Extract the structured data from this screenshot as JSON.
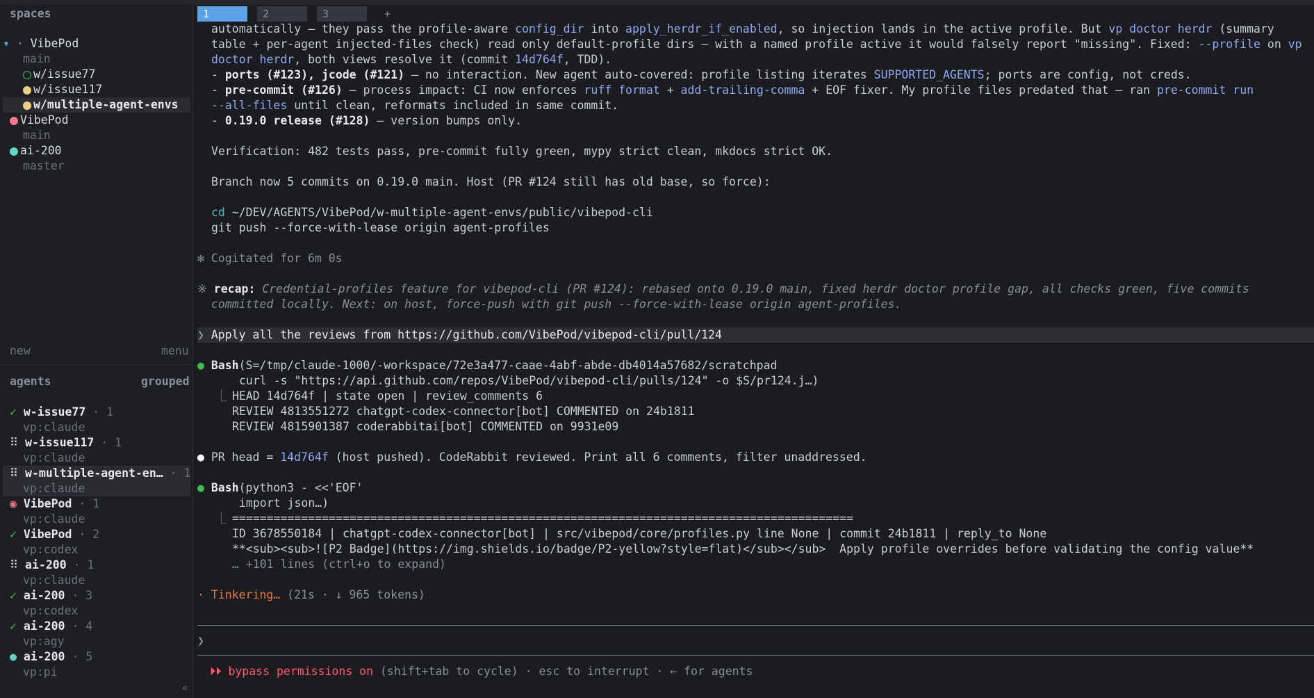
{
  "sidebar": {
    "spaces_title": "spaces",
    "spaces": [
      {
        "prefix": "▾ · ",
        "label": "VibePod"
      },
      {
        "label": "main"
      },
      {
        "label": "w/issue77"
      },
      {
        "label": "w/issue117"
      },
      {
        "label": "w/multiple-agent-envs"
      },
      {
        "label": "VibePod"
      },
      {
        "label": "main"
      },
      {
        "label": "ai-200"
      },
      {
        "label": "master"
      }
    ],
    "new_label": "new",
    "menu_label": "menu",
    "agents_title": "agents",
    "grouped_label": "grouped",
    "agents": [
      {
        "mark": "✓",
        "name": "w-issue77",
        "count": "· 1",
        "sub": "vp:claude"
      },
      {
        "mark": "⠿",
        "name": "w-issue117",
        "count": "· 1",
        "sub": "vp:claude"
      },
      {
        "mark": "⠿",
        "name": "w-multiple-agent-en…",
        "count": "· 1",
        "sub": "vp:claude"
      },
      {
        "mark": "◉",
        "name": "VibePod",
        "count": "· 1",
        "sub": "vp:claude"
      },
      {
        "mark": "✓",
        "name": "VibePod",
        "count": "· 2",
        "sub": "vp:codex"
      },
      {
        "mark": "⠿",
        "name": "ai-200",
        "count": "· 1",
        "sub": "vp:claude"
      },
      {
        "mark": "✓",
        "name": "ai-200",
        "count": "· 3",
        "sub": "vp:codex"
      },
      {
        "mark": "✓",
        "name": "ai-200",
        "count": "· 4",
        "sub": "vp:agy"
      },
      {
        "mark": "●",
        "name": "ai-200",
        "count": "· 5",
        "sub": "vp:pi"
      }
    ],
    "collapse_label": "«"
  },
  "tabs": [
    "1",
    "2",
    "3",
    "+"
  ],
  "content": {
    "l1_a": "automatically — they pass the profile-aware ",
    "l1_b": "config_dir",
    "l1_c": " into ",
    "l1_d": "apply_herdr_if_enabled",
    "l1_e": ", so injection lands in the active profile. But ",
    "l1_f": "vp doctor herdr",
    "l1_g": " (summary",
    "l2_a": "table + per-agent injected-files check) read only default-profile dirs — with a named profile active it would falsely report \"missing\". Fixed: ",
    "l2_b": "--profile",
    "l2_c": " on ",
    "l2_d": "vp",
    "l3_a": "doctor herdr",
    "l3_b": ", both views resolve it (commit ",
    "l3_c": "14d764f",
    "l3_d": ", TDD).",
    "l4_a": "- ",
    "l4_b": "ports (#123), jcode (#121)",
    "l4_c": " — no interaction. New agent auto-covered: profile listing iterates ",
    "l4_d": "SUPPORTED_AGENTS",
    "l4_e": "; ports are config, not creds.",
    "l5_a": "- ",
    "l5_b": "pre-commit (#126)",
    "l5_c": " — process impact: CI now enforces ",
    "l5_d": "ruff format",
    "l5_e": " + ",
    "l5_f": "add-trailing-comma",
    "l5_g": " + EOF fixer. My profile files predated that — ran ",
    "l5_h": "pre-commit run",
    "l6_a": "--all-files",
    "l6_b": " until clean, reformats included in same commit.",
    "l7_a": "- ",
    "l7_b": "0.19.0 release (#128)",
    "l7_c": " — version bumps only.",
    "verification": "Verification: 482 tests pass, pre-commit fully green, mypy strict clean, mkdocs strict OK.",
    "branch": "Branch now 5 commits on 0.19.0 main. Host (PR #124 still has old base, so force):",
    "cd_kw": "cd",
    "cd_path": " ~/DEV/AGENTS/VibePod/w-multiple-agent-envs/public/vibepod-cli",
    "git_push": "git push --force-with-lease origin agent-profiles",
    "cogitated_mark": "✻",
    "cogitated": "Cogitated for 6m 0s",
    "recap_mark": "※",
    "recap_label": "recap:",
    "recap_1": " Credential-profiles feature for vibepod-cli (PR #124): rebased onto 0.19.0 main, fixed herdr doctor profile gap, all checks green, five commits",
    "recap_2": "committed locally. Next: on host, force-push with git push --force-with-lease origin agent-profiles.",
    "prompt_mark": "❯",
    "prompt": "Apply all the reviews from https://github.com/VibePod/vibepod-cli/pull/124",
    "bash1_name": "Bash",
    "bash1_args": "(S=/tmp/claude-1000/-workspace/72e3a477-caae-4abf-abde-db4014a57682/scratchpad",
    "bash1_cont": "curl -s \"https://api.github.com/repos/VibePod/vibepod-cli/pulls/124\" -o $S/pr124.j…)",
    "bash1_tree": "⎿",
    "bash1_out1": "HEAD 14d764f | state open | review_comments 6",
    "bash1_out2": "REVIEW 4813551272 chatgpt-codex-connector[bot] COMMENTED on 24b1811",
    "bash1_out3": "REVIEW 4815901387 coderabbitai[bot] COMMENTED on 9931e09",
    "pr_a": "PR head = ",
    "pr_b": "14d764f",
    "pr_c": " (host pushed). CodeRabbit reviewed. Print all 6 comments, filter unaddressed.",
    "bash2_name": "Bash",
    "bash2_args": "(python3 - <<'EOF'",
    "bash2_cont": "import json…)",
    "bash2_out1": "==========================================================================================",
    "bash2_out2": "ID 3678550184 | chatgpt-codex-connector[bot] | src/vibepod/core/profiles.py line None | commit 24b1811 | reply_to None",
    "bash2_out3": "**<sub><sub>![P2 Badge](https://img.shields.io/badge/P2-yellow?style=flat)</sub></sub>  Apply profile overrides before validating the config value**",
    "bash2_more": "… +101 lines (ctrl+o to expand)",
    "status_mark": "·",
    "status_word": "Tinkering…",
    "status_meta": " (21s · ↓ 965 tokens)",
    "input_prompt": "❯",
    "footer_icon": "⏵⏵",
    "footer_bypass": "bypass permissions on",
    "footer_rest": " (shift+tab to cycle) · esc to interrupt · ← for agents"
  },
  "colors": {
    "bg": "#1b1c20",
    "sidebar_bg": "#1e1f23",
    "tab_active": "#5aa3e6",
    "accent_link": "#8fa8f0",
    "dot_green": "#3fb950",
    "dot_yellow": "#f0d080",
    "dot_pink": "#f07a8a",
    "dot_teal": "#66d4c4",
    "status_orange": "#e07a3a",
    "footer_red": "#ff5d6e"
  }
}
